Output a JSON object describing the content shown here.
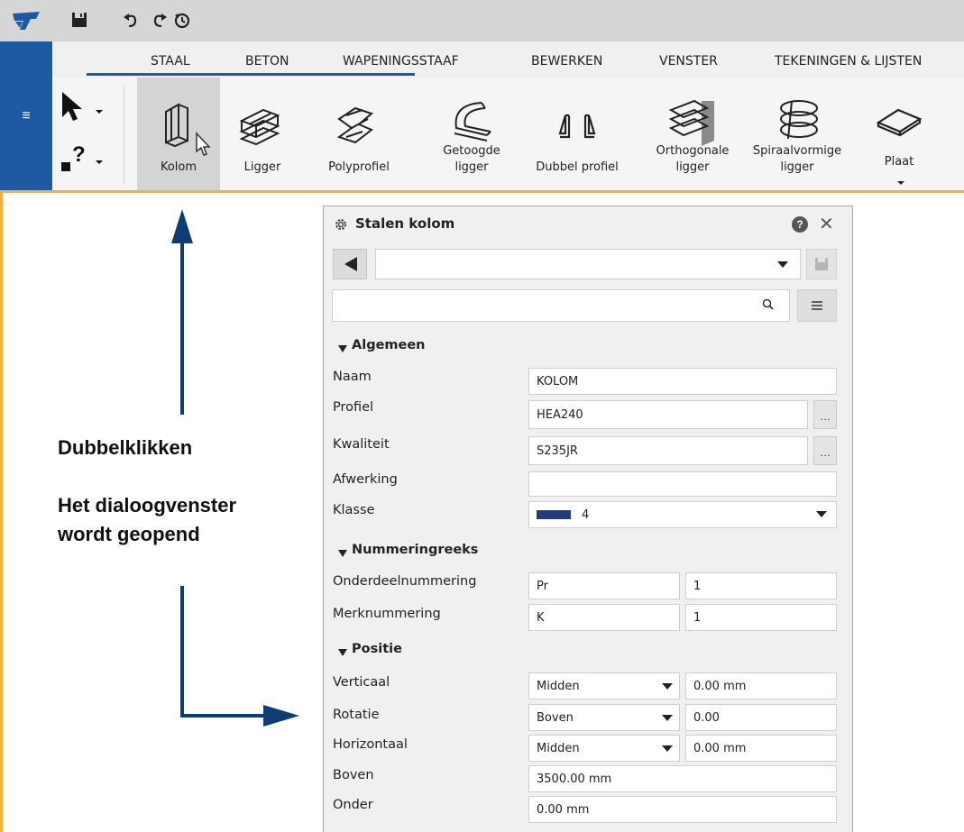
{
  "quick_access": {
    "logo_icon": "tekla-logo-icon",
    "save_icon": "floppy-disk-icon",
    "undo_icon": "undo-icon",
    "redo_icon": "redo-icon",
    "history_icon": "history-icon"
  },
  "side_menu_icon": "≡",
  "tabs": [
    "STAAL",
    "BETON",
    "WAPENINGSSTAAF",
    "BEWERKEN",
    "VENSTER",
    "TEKENINGEN & LIJSTEN"
  ],
  "active_tab": "STAAL",
  "ribbon": {
    "selection_help": "?",
    "commands": {
      "kolom": "Kolom",
      "ligger": "Ligger",
      "polyprofiel": "Polyprofiel",
      "getoogde_1": "Getoogde",
      "getoogde_2": "ligger",
      "dubbel": "Dubbel profiel",
      "ortho_1": "Orthogonale",
      "ortho_2": "ligger",
      "spiraal_1": "Spiraalvormige",
      "spiraal_2": "ligger",
      "plaat": "Plaat"
    }
  },
  "annotation": {
    "line1": "Dubbelklikken",
    "line2": "Het dialoogvenster",
    "line3": "wordt geopend"
  },
  "dialog": {
    "title": "Stalen kolom",
    "help_icon": "?",
    "close_icon": "✕",
    "preset_value": "",
    "search_placeholder": "",
    "sections": {
      "algemeen": "Algemeen",
      "nummering": "Nummeringreeks",
      "positie": "Positie"
    },
    "fields": {
      "naam_label": "Naam",
      "naam_value": "KOLOM",
      "profiel_label": "Profiel",
      "profiel_value": "HEA240",
      "kwaliteit_label": "Kwaliteit",
      "kwaliteit_value": "S235JR",
      "afwerking_label": "Afwerking",
      "afwerking_value": "",
      "klasse_label": "Klasse",
      "klasse_value": "4",
      "klasse_color": "#1f3f7a",
      "onderdeel_label": "Onderdeelnummering",
      "onderdeel_prefix": "Pr",
      "onderdeel_start": "1",
      "merk_label": "Merknummering",
      "merk_prefix": "K",
      "merk_start": "1",
      "verticaal_label": "Verticaal",
      "verticaal_value": "Midden",
      "verticaal_offset": "0.00 mm",
      "rotatie_label": "Rotatie",
      "rotatie_value": "Boven",
      "rotatie_offset": "0.00",
      "horizontaal_label": "Horizontaal",
      "horizontaal_value": "Midden",
      "horizontaal_offset": "0.00 mm",
      "boven_label": "Boven",
      "boven_value": "3500.00 mm",
      "onder_label": "Onder",
      "onder_value": "0.00 mm"
    }
  },
  "colors": {
    "brand_blue": "#1d5aa3",
    "accent_orange": "#f3b23c",
    "arrow_blue": "#0e3d73"
  }
}
